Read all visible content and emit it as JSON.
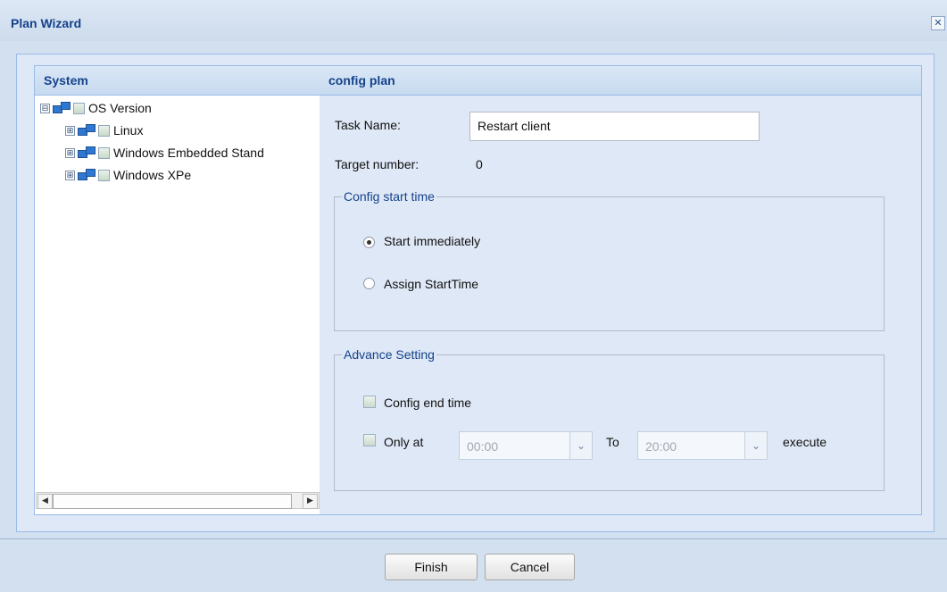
{
  "window": {
    "title": "Plan Wizard",
    "close_glyph": "✕"
  },
  "left_panel": {
    "header": "System",
    "tree": [
      {
        "label": "OS Version",
        "expander": "⊟",
        "level": 0
      },
      {
        "label": "Linux",
        "expander": "⊞",
        "level": 1
      },
      {
        "label": "Windows Embedded Stand",
        "expander": "⊞",
        "level": 1
      },
      {
        "label": "Windows XPe",
        "expander": "⊞",
        "level": 1
      }
    ],
    "scroll_left": "◀",
    "scroll_right": "▶"
  },
  "right_panel": {
    "header": "config plan",
    "task_name_label": "Task Name:",
    "task_name_value": "Restart client",
    "target_number_label": "Target number:",
    "target_number_value": "0",
    "start_time": {
      "legend": "Config start time",
      "opt_immediate": "Start immediately",
      "opt_assign": "Assign StartTime",
      "selected": "Start immediately"
    },
    "advance": {
      "legend": "Advance Setting",
      "config_end_time": "Config end time",
      "only_at": "Only at",
      "from_value": "00:00",
      "to_label": "To",
      "to_value": "20:00",
      "execute_label": "execute"
    }
  },
  "footer": {
    "finish": "Finish",
    "cancel": "Cancel"
  },
  "icons": {
    "dropdown": "chevron-down-icon",
    "computer": "computer-icon"
  }
}
